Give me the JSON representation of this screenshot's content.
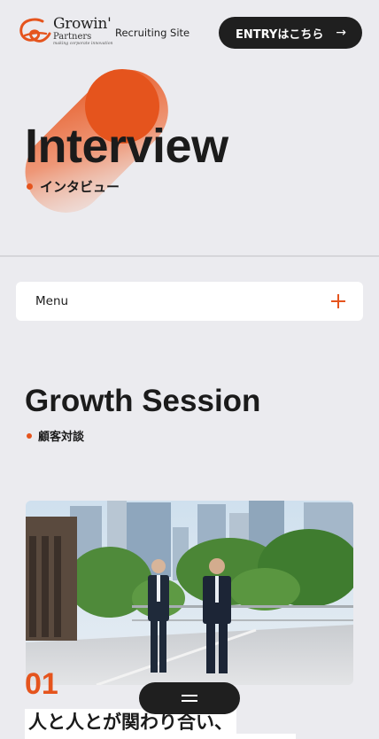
{
  "header": {
    "logo": {
      "name": "Growin'",
      "sub": "Partners",
      "tagline": "making corporate innovation"
    },
    "site_label": "Recruiting Site",
    "entry_button": {
      "label": "ENTRYはこちら",
      "arrow": "→"
    }
  },
  "hero": {
    "title": "Interview",
    "subtitle": "インタビュー"
  },
  "menu": {
    "label": "Menu",
    "icon": "plus-icon"
  },
  "section": {
    "title": "Growth Session",
    "subtitle": "顧客対談"
  },
  "article": {
    "number": "01",
    "headline": "人と人とが関わり合い、"
  },
  "floating_menu": {
    "icon": "hamburger-icon"
  },
  "colors": {
    "accent": "#e5541d",
    "background": "#ebebef",
    "dark": "#1f1f1f"
  }
}
